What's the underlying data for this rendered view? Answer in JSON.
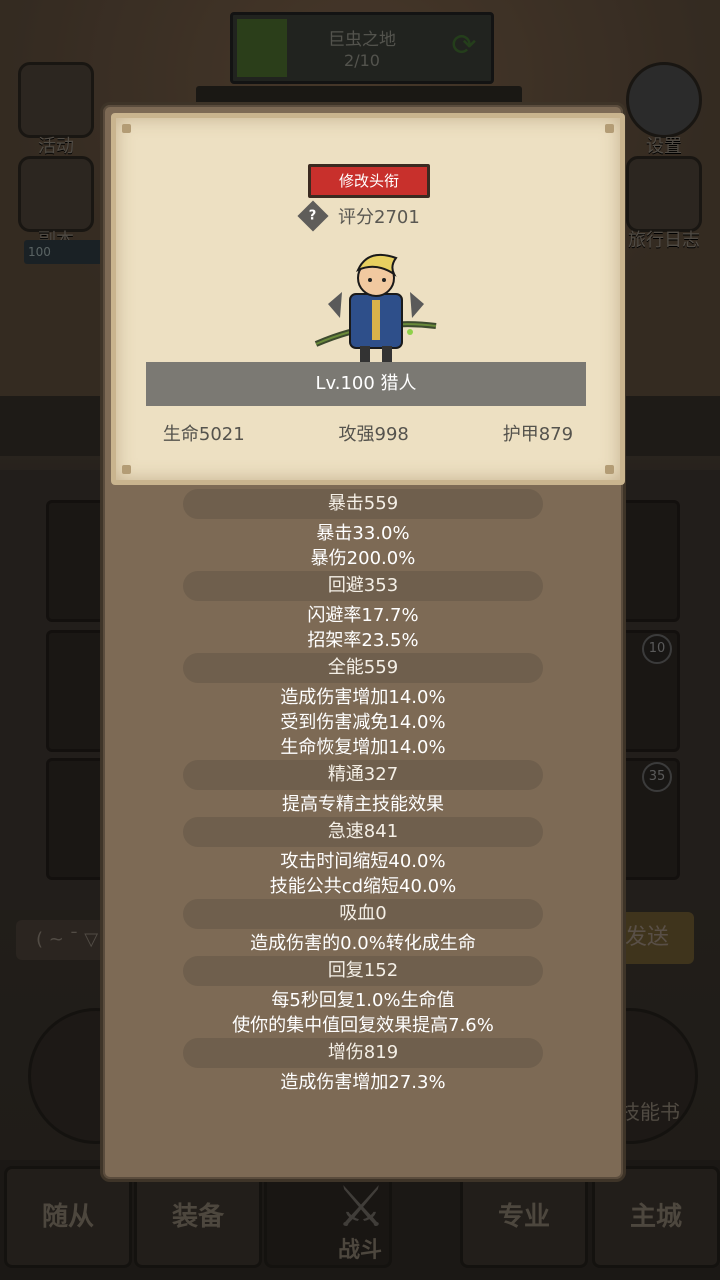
{
  "background": {
    "stage": {
      "title": "巨虫之地",
      "count": "2/10"
    },
    "left_buttons": [
      {
        "label": "活动",
        "icon": "scroll-icon"
      },
      {
        "label": "副本",
        "icon": "portal-icon"
      }
    ],
    "right_buttons": [
      {
        "label": "设置",
        "icon": "gear-icon"
      },
      {
        "label": "旅行日志",
        "icon": "journal-icon"
      }
    ],
    "level_chip": "100",
    "slot_badges": [
      "10",
      "35"
    ],
    "emote_text": "( ~ ¯ ▽",
    "send_label": "发送",
    "skillbook_label": "技能书",
    "nav_tabs": [
      "随从",
      "装备",
      "战斗",
      "专业",
      "主城"
    ]
  },
  "dialog": {
    "rename_label": "修改头衔",
    "score": "评分2701",
    "name": "Lv.100 猎人",
    "base_stats": [
      "生命5021",
      "攻强998",
      "护甲879"
    ],
    "stat_groups": [
      {
        "header": "暴击559",
        "lines": [
          "暴击33.0%",
          "暴伤200.0%"
        ]
      },
      {
        "header": "回避353",
        "lines": [
          "闪避率17.7%",
          "招架率23.5%"
        ]
      },
      {
        "header": "全能559",
        "lines": [
          "造成伤害增加14.0%",
          "受到伤害减免14.0%",
          "生命恢复增加14.0%"
        ]
      },
      {
        "header": "精通327",
        "lines": [
          "提高专精主技能效果"
        ]
      },
      {
        "header": "急速841",
        "lines": [
          "攻击时间缩短40.0%",
          "技能公共cd缩短40.0%"
        ]
      },
      {
        "header": "吸血0",
        "lines": [
          "造成伤害的0.0%转化成生命"
        ]
      },
      {
        "header": "回复152",
        "lines": [
          "每5秒回复1.0%生命值",
          "使你的集中值回复效果提高7.6%"
        ]
      },
      {
        "header": "增伤819",
        "lines": [
          "造成伤害增加27.3%"
        ]
      }
    ]
  },
  "colors": {
    "rename_button": "#c8302c",
    "parchment": "#ede0c2",
    "dialog_body": "#7d6a55"
  }
}
